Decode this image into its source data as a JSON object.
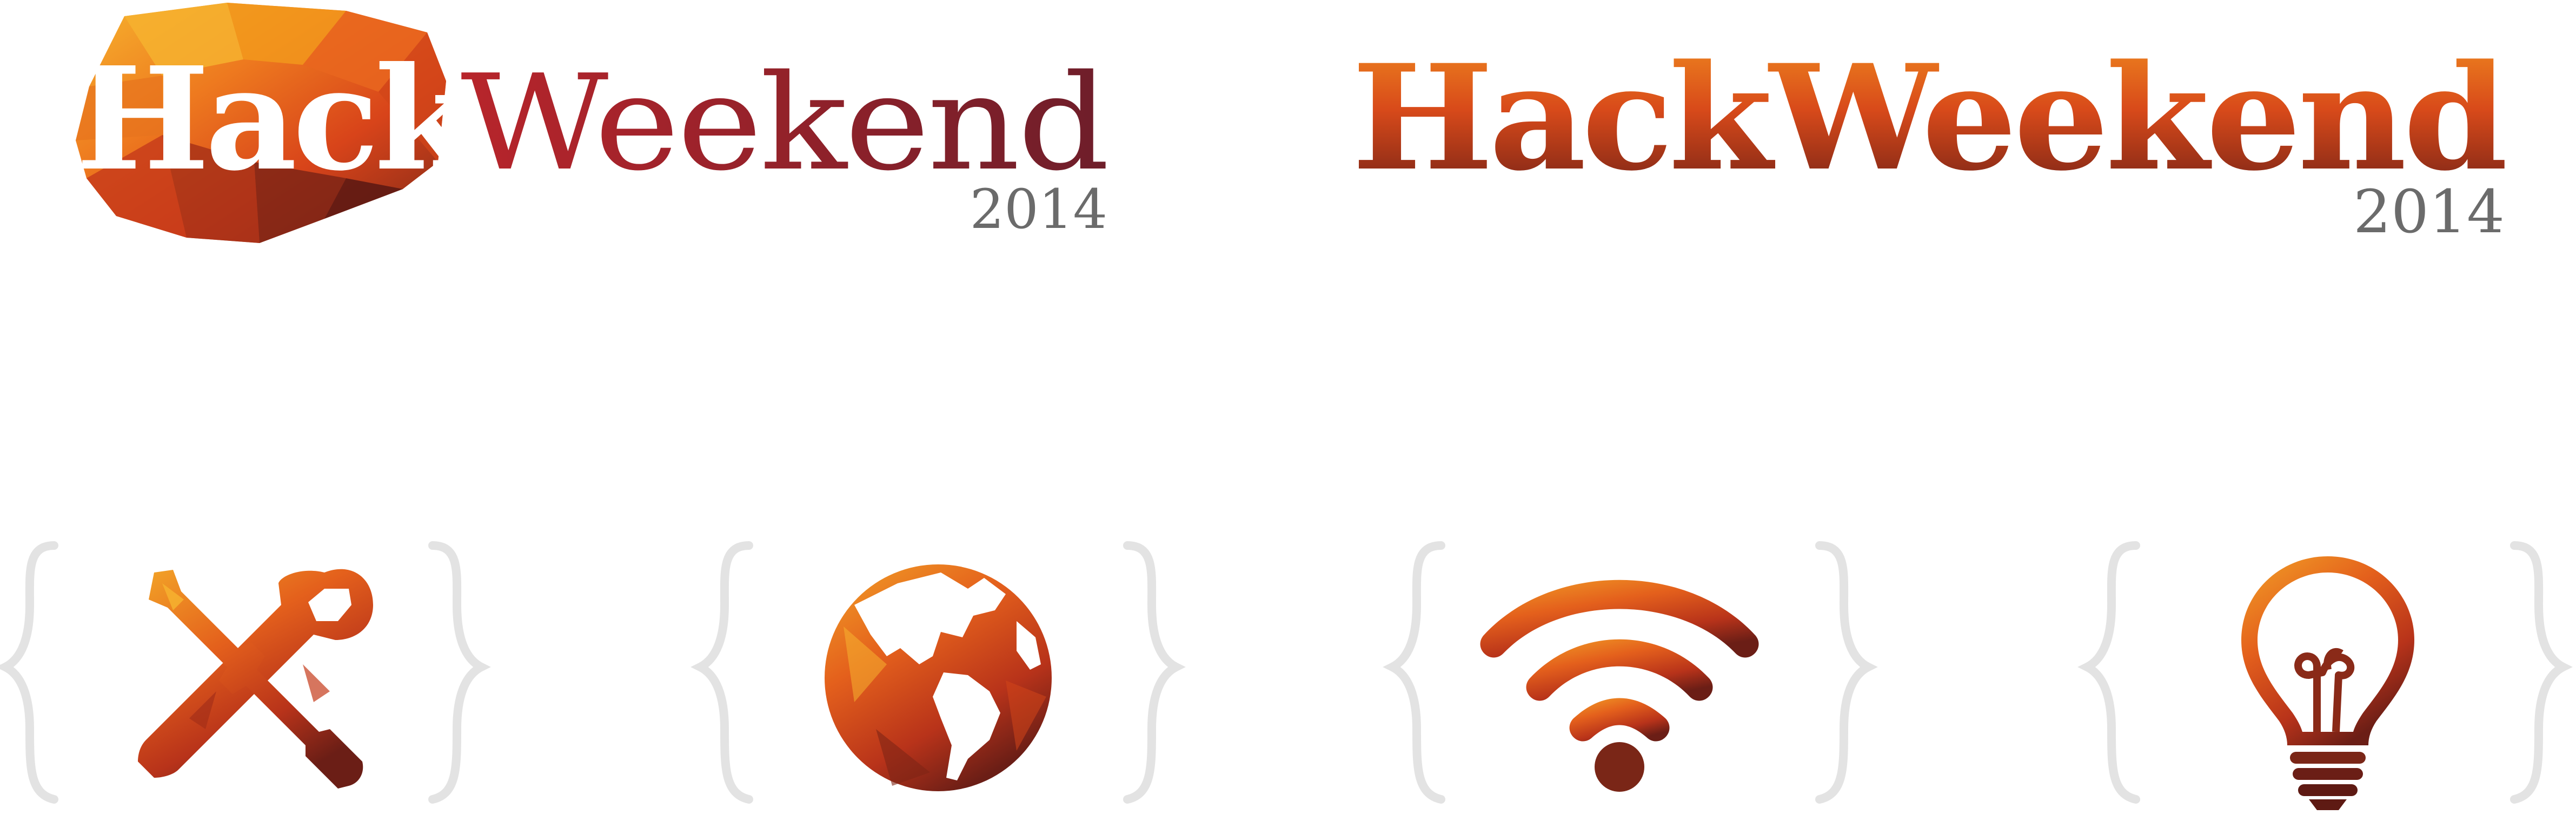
{
  "logo_primary": {
    "hack": "Hack",
    "weekend": "Weekend",
    "year": "2014"
  },
  "logo_secondary": {
    "hack": "Hack",
    "weekend": "Weekend",
    "year": "2014"
  },
  "icons": [
    {
      "icon": "tools-wrench-screwdriver-icon"
    },
    {
      "icon": "globe-americas-icon"
    },
    {
      "icon": "wifi-signal-icon"
    },
    {
      "icon": "lightbulb-icon"
    }
  ],
  "colors": {
    "brand_orange": "#F39A1C",
    "brand_red": "#D8441A",
    "brand_dark": "#6B1E16",
    "weekend_crimson": "#A01E2C",
    "year_gray": "#6B6B6B",
    "brace_gray": "#E3E3E3"
  }
}
